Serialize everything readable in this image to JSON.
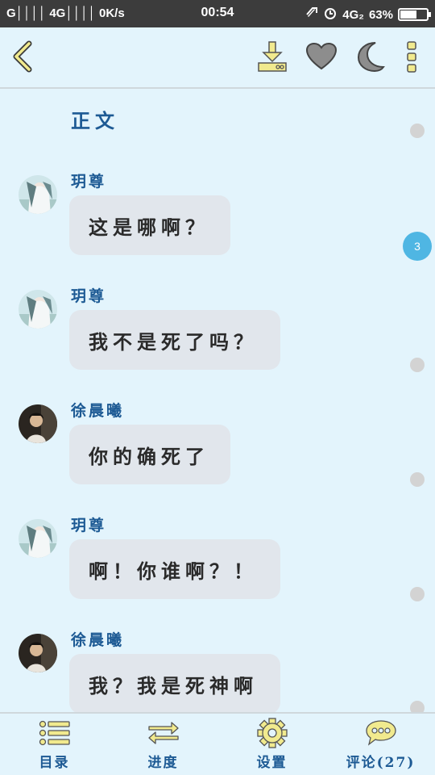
{
  "status_bar": {
    "signal": "G││││ 4G││││ 0K/s",
    "time": "00:54",
    "network": "4G₂",
    "battery": "63%",
    "battery_level": 0.63
  },
  "toolbar": {
    "back_icon": "chevron-left-icon",
    "download_icon": "download-icon",
    "favorite_icon": "heart-icon",
    "night_mode_icon": "moon-icon",
    "more_icon": "more-vertical-icon"
  },
  "content": {
    "section_title": "正文",
    "badge_count": "3",
    "messages": [
      {
        "sender": "玥尊",
        "text": "这是哪啊？"
      },
      {
        "sender": "玥尊",
        "text": "我不是死了吗？"
      },
      {
        "sender": "徐晨曦",
        "text": "你的确死了"
      },
      {
        "sender": "玥尊",
        "text": "啊！你谁啊？！"
      },
      {
        "sender": "徐晨曦",
        "text": "我？我是死神啊"
      }
    ]
  },
  "bottom_nav": {
    "items": [
      {
        "label": "目录",
        "icon": "list-icon"
      },
      {
        "label": "进度",
        "icon": "swap-arrows-icon"
      },
      {
        "label": "设置",
        "icon": "gear-icon"
      },
      {
        "label": "评论(27)",
        "icon": "comment-bubble-icon"
      }
    ]
  },
  "colors": {
    "background": "#e3f4fc",
    "title_blue": "#1d5a94",
    "bubble": "#e1e6ec",
    "icon_yellow": "#f1ea8e",
    "badge_blue": "#4fb6e3"
  }
}
